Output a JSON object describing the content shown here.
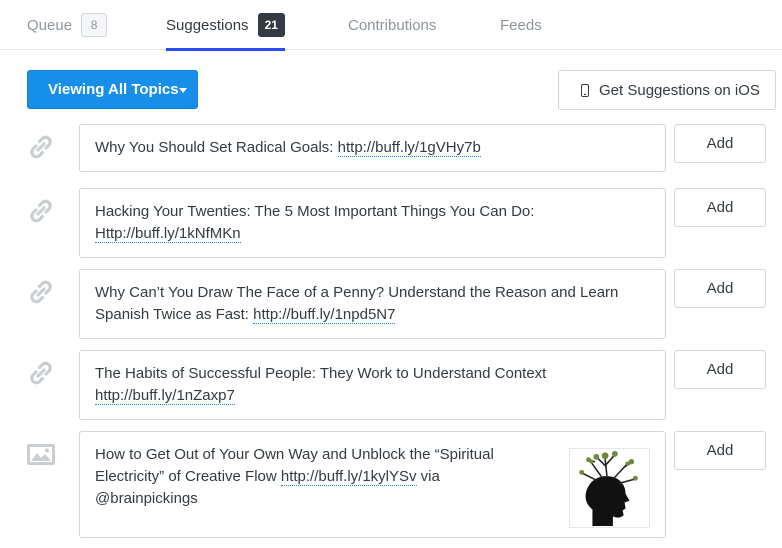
{
  "tabs": [
    {
      "label": "Queue",
      "count": "8",
      "active": false
    },
    {
      "label": "Suggestions",
      "count": "21",
      "active": true
    },
    {
      "label": "Contributions",
      "active": false
    },
    {
      "label": "Feeds",
      "active": false
    }
  ],
  "toolbar": {
    "topic_label": "Viewing All Topics",
    "ios_label": "Get Suggestions on iOS"
  },
  "suggestions": [
    {
      "text": "Why You Should Set Radical Goals: ",
      "link": "http://buff.ly/1gVHy7b",
      "suffix": "",
      "icon": "link-icon",
      "add_label": "Add"
    },
    {
      "text": "Hacking Your Twenties: The 5 Most Important Things You Can Do: ",
      "link": "Http://buff.ly/1kNfMKn",
      "suffix": "",
      "icon": "link-icon",
      "add_label": "Add"
    },
    {
      "text": "Why Can’t You Draw The Face of a Penny? Understand the Reason and Learn Spanish Twice as Fast: ",
      "link": "http://buff.ly/1npd5N7",
      "suffix": "",
      "icon": "link-icon",
      "add_label": "Add"
    },
    {
      "text": "The Habits of Successful People: They Work to Understand Context ",
      "link": "http://buff.ly/1nZaxp7",
      "suffix": "",
      "icon": "link-icon",
      "add_label": "Add"
    },
    {
      "text": "How to Get Out of Your Own Way and Unblock the “Spiritual Electricity” of Creative Flow ",
      "link": "http://buff.ly/1kylYSv",
      "suffix": " via @brainpickings",
      "icon": "image-icon",
      "add_label": "Add"
    }
  ],
  "colors": {
    "primary_blue": "#168eea",
    "tab_underline": "#2c4bff",
    "dark_badge": "#323b43",
    "icon_gray": "#c8ced4",
    "border": "#ced7df"
  }
}
